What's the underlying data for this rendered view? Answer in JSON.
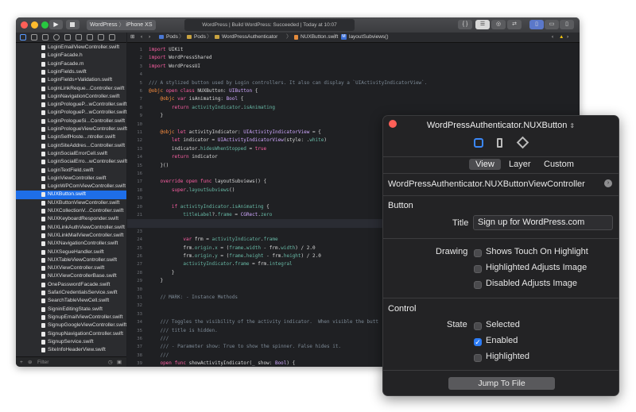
{
  "xcode": {
    "scheme_target": "WordPress",
    "scheme_device": "iPhone XS",
    "activity": "WordPress | Build WordPress: Succeeded | Today at 10:07",
    "jumpbar": [
      "Pods",
      "Pods",
      "WordPressAuthenticator",
      "NUXButton.swift",
      "layoutSubviews()"
    ],
    "filter_placeholder": "Filter",
    "files": [
      "LoginEmailViewController.swift",
      "LoginFacade.h",
      "LoginFacade.m",
      "LoginFields.swift",
      "LoginFields+Validation.swift",
      "LoginLinkReque...Controller.swift",
      "LoginNavigationController.swift",
      "LoginPrologueP...wController.swift",
      "LoginPrologueP...wController.swift",
      "LoginPrologueSi...Controller.swift",
      "LoginPrologueViewController.swift",
      "LoginSelfHoste...ntroller.swift",
      "LoginSiteAddres...Controller.swift",
      "LoginSocialErrorCell.swift",
      "LoginSocialErro...wController.swift",
      "LoginTextField.swift",
      "LoginViewController.swift",
      "LoginWPComViewController.swift",
      "NUXButton.swift",
      "NUXButtonViewController.swift",
      "NUXCollectionV...Controller.swift",
      "NUXKeyboardResponder.swift",
      "NUXLinkAuthViewController.swift",
      "NUXLinkMailViewController.swift",
      "NUXNavigationController.swift",
      "NUXSegueHandler.swift",
      "NUXTableViewController.swift",
      "NUXViewController.swift",
      "NUXViewControllerBase.swift",
      "OnePasswordFacade.swift",
      "SafariCredentialsService.swift",
      "SearchTableViewCell.swift",
      "SigninEditingState.swift",
      "SignupEmailViewController.swift",
      "SignupGoogleViewController.swift",
      "SignupNavigationController.swift",
      "SignupService.swift",
      "SiteInfoHeaderView.swift"
    ],
    "selected_file_index": 18,
    "line_numbers": [
      "1",
      "2",
      "3",
      "4",
      "5",
      "6",
      "7",
      "8",
      "9",
      "10",
      "11",
      "12",
      "13",
      "14",
      "15",
      "16",
      "17",
      "18",
      "19",
      "20",
      "21",
      "22",
      "23",
      "24",
      "25",
      "26",
      "27",
      "28",
      "29",
      "30",
      "31",
      "32",
      "33",
      "34",
      "35",
      "36",
      "37",
      "38",
      "39",
      "40",
      "41",
      "42",
      "43",
      "44",
      "45",
      "46"
    ],
    "current_line_index": 21,
    "code": [
      [
        [
          "k",
          "import"
        ],
        [
          "t",
          " UIKit"
        ]
      ],
      [
        [
          "k",
          "import"
        ],
        [
          "t",
          " WordPressShared"
        ]
      ],
      [
        [
          "k",
          "import"
        ],
        [
          "t",
          " WordPressUI"
        ]
      ],
      [],
      [
        [
          "c",
          "/// A stylized button used by Login controllers. It also can display a `UIActivityIndicatorView`."
        ]
      ],
      [
        [
          "a",
          "@objc"
        ],
        [
          "t",
          " "
        ],
        [
          "k",
          "open class"
        ],
        [
          "t",
          " NUXButton: "
        ],
        [
          "y",
          "UIButton"
        ],
        [
          "t",
          " {"
        ]
      ],
      [
        [
          "t",
          "    "
        ],
        [
          "a",
          "@objc"
        ],
        [
          "t",
          " "
        ],
        [
          "k",
          "var"
        ],
        [
          "t",
          " isAnimating: "
        ],
        [
          "y",
          "Bool"
        ],
        [
          "t",
          " {"
        ]
      ],
      [
        [
          "t",
          "        "
        ],
        [
          "k",
          "return"
        ],
        [
          "t",
          " "
        ],
        [
          "f",
          "activityIndicator"
        ],
        [
          "t",
          "."
        ],
        [
          "f",
          "isAnimating"
        ]
      ],
      [
        [
          "t",
          "    }"
        ]
      ],
      [],
      [
        [
          "t",
          "    "
        ],
        [
          "a",
          "@objc"
        ],
        [
          "t",
          " "
        ],
        [
          "k",
          "let"
        ],
        [
          "t",
          " activityIndicator: "
        ],
        [
          "y",
          "UIActivityIndicatorView"
        ],
        [
          "t",
          " = {"
        ]
      ],
      [
        [
          "t",
          "        "
        ],
        [
          "k",
          "let"
        ],
        [
          "t",
          " indicator = "
        ],
        [
          "y",
          "UIActivityIndicatorView"
        ],
        [
          "t",
          "(style: ."
        ],
        [
          "f",
          "white"
        ],
        [
          "t",
          ")"
        ]
      ],
      [
        [
          "t",
          "        indicator."
        ],
        [
          "f",
          "hidesWhenStopped"
        ],
        [
          "t",
          " = "
        ],
        [
          "k",
          "true"
        ]
      ],
      [
        [
          "t",
          "        "
        ],
        [
          "k",
          "return"
        ],
        [
          "t",
          " indicator"
        ]
      ],
      [
        [
          "t",
          "    }()"
        ]
      ],
      [],
      [
        [
          "t",
          "    "
        ],
        [
          "k",
          "override open func"
        ],
        [
          "t",
          " layoutSubviews() {"
        ]
      ],
      [
        [
          "t",
          "        "
        ],
        [
          "k",
          "super"
        ],
        [
          "t",
          "."
        ],
        [
          "f",
          "layoutSubviews"
        ],
        [
          "t",
          "()"
        ]
      ],
      [],
      [
        [
          "t",
          "        "
        ],
        [
          "k",
          "if"
        ],
        [
          "t",
          " "
        ],
        [
          "f",
          "activityIndicator"
        ],
        [
          "t",
          "."
        ],
        [
          "f",
          "isAnimating"
        ],
        [
          "t",
          " {"
        ]
      ],
      [
        [
          "t",
          "            "
        ],
        [
          "f",
          "titleLabel"
        ],
        [
          "t",
          "?."
        ],
        [
          "f",
          "frame"
        ],
        [
          "t",
          " = "
        ],
        [
          "y",
          "CGRect"
        ],
        [
          "t",
          "."
        ],
        [
          "f",
          "zero"
        ]
      ],
      [],
      [],
      [
        [
          "t",
          "            "
        ],
        [
          "k",
          "var"
        ],
        [
          "t",
          " frm = "
        ],
        [
          "f",
          "activityIndicator"
        ],
        [
          "t",
          "."
        ],
        [
          "f",
          "frame"
        ]
      ],
      [
        [
          "t",
          "            frm."
        ],
        [
          "f",
          "origin"
        ],
        [
          "t",
          "."
        ],
        [
          "f",
          "x"
        ],
        [
          "t",
          " = ("
        ],
        [
          "f",
          "frame"
        ],
        [
          "t",
          "."
        ],
        [
          "f",
          "width"
        ],
        [
          "t",
          " - frm."
        ],
        [
          "f",
          "width"
        ],
        [
          "t",
          ") / 2.0"
        ]
      ],
      [
        [
          "t",
          "            frm."
        ],
        [
          "f",
          "origin"
        ],
        [
          "t",
          "."
        ],
        [
          "f",
          "y"
        ],
        [
          "t",
          " = ("
        ],
        [
          "f",
          "frame"
        ],
        [
          "t",
          "."
        ],
        [
          "f",
          "height"
        ],
        [
          "t",
          " - frm."
        ],
        [
          "f",
          "height"
        ],
        [
          "t",
          ") / 2.0"
        ]
      ],
      [
        [
          "t",
          "            "
        ],
        [
          "f",
          "activityIndicator"
        ],
        [
          "t",
          "."
        ],
        [
          "f",
          "frame"
        ],
        [
          "t",
          " = frm."
        ],
        [
          "f",
          "integral"
        ]
      ],
      [
        [
          "t",
          "        }"
        ]
      ],
      [
        [
          "t",
          "    }"
        ]
      ],
      [],
      [
        [
          "c",
          "    // MARK: - Instance Methods"
        ]
      ],
      [],
      [],
      [
        [
          "c",
          "    /// Toggles the visibility of the activity indicator.  When visible the butt"
        ]
      ],
      [
        [
          "c",
          "    /// title is hidden."
        ]
      ],
      [
        [
          "c",
          "    ///"
        ]
      ],
      [
        [
          "c",
          "    /// - Parameter show: True to show the spinner. False hides it."
        ]
      ],
      [
        [
          "c",
          "    ///"
        ]
      ],
      [
        [
          "t",
          "    "
        ],
        [
          "k",
          "open func"
        ],
        [
          "t",
          " showActivityIndicator(_ show: "
        ],
        [
          "y",
          "Bool"
        ],
        [
          "t",
          ") {"
        ]
      ],
      [
        [
          "t",
          "        "
        ],
        [
          "k",
          "if"
        ],
        [
          "t",
          " show {"
        ]
      ],
      [
        [
          "t",
          "            "
        ],
        [
          "f",
          "activityIndicator"
        ],
        [
          "t",
          "."
        ],
        [
          "f",
          "startAnimating"
        ],
        [
          "t",
          "()"
        ]
      ],
      [
        [
          "t",
          "        } "
        ],
        [
          "k",
          "else"
        ],
        [
          "t",
          " {"
        ]
      ],
      [
        [
          "t",
          "            "
        ],
        [
          "f",
          "activityIndicator"
        ],
        [
          "t",
          "."
        ],
        [
          "f",
          "stopAnimating"
        ],
        [
          "t",
          "()"
        ]
      ],
      [
        [
          "t",
          "        }"
        ]
      ],
      [
        [
          "t",
          "        "
        ],
        [
          "f",
          "setNeedsLayout"
        ],
        [
          "t",
          "()"
        ]
      ],
      [
        [
          "t",
          "    }"
        ]
      ]
    ]
  },
  "inspector": {
    "title": "WordPressAuthenticator.NUXButton",
    "tabs": [
      "View",
      "Layer",
      "Custom"
    ],
    "class_name": "WordPressAuthenticator.NUXButtonViewController",
    "button_section": "Button",
    "title_label": "Title",
    "title_value": "Sign up for WordPress.com",
    "drawing_label": "Drawing",
    "drawing_options": [
      {
        "label": "Shows Touch On Highlight",
        "checked": false
      },
      {
        "label": "Highlighted Adjusts Image",
        "checked": false
      },
      {
        "label": "Disabled Adjusts Image",
        "checked": false
      }
    ],
    "control_section": "Control",
    "state_label": "State",
    "state_options": [
      {
        "label": "Selected",
        "checked": false
      },
      {
        "label": "Enabled",
        "checked": true
      },
      {
        "label": "Highlighted",
        "checked": false
      }
    ],
    "jump_button": "Jump To File"
  },
  "colors": {
    "keyword": "#fc5fa3",
    "type": "#d0a8ff",
    "attribute": "#fd8f3f",
    "comment": "#7d8a96",
    "field": "#67b7a4",
    "text": "#d8d8d8",
    "selection": "#1e6ee8",
    "checkbox_on": "#2d7cf6",
    "close_red": "#ff5f57"
  }
}
